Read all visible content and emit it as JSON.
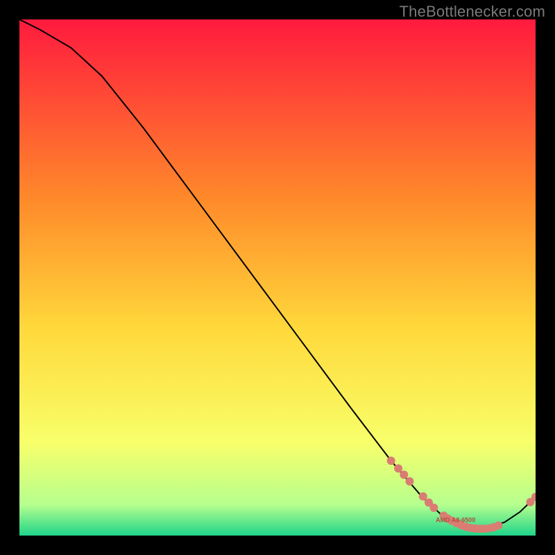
{
  "watermark": "TheBottlenecker.com",
  "colors": {
    "bg": "#000000",
    "curve": "#000000",
    "marker": "#d97d73",
    "label": "#b84a3f",
    "gradient_top": "#ff1a3e",
    "gradient_mid1": "#ff8a2a",
    "gradient_mid2": "#ffd93b",
    "gradient_mid3": "#f8ff6a",
    "gradient_mid4": "#b6ff8e",
    "gradient_bottom": "#1fd48a"
  },
  "chart_data": {
    "type": "line",
    "title": "",
    "xlabel": "",
    "ylabel": "",
    "xlim": [
      0,
      100
    ],
    "ylim": [
      0,
      100
    ],
    "label_text": "AMD A8-6500",
    "curve": [
      {
        "x": 0,
        "y": 100
      },
      {
        "x": 4,
        "y": 98
      },
      {
        "x": 10,
        "y": 94.5
      },
      {
        "x": 16,
        "y": 89
      },
      {
        "x": 24,
        "y": 79
      },
      {
        "x": 34,
        "y": 65.5
      },
      {
        "x": 44,
        "y": 52
      },
      {
        "x": 54,
        "y": 38.5
      },
      {
        "x": 64,
        "y": 25
      },
      {
        "x": 72,
        "y": 14.5
      },
      {
        "x": 78,
        "y": 7.5
      },
      {
        "x": 82,
        "y": 3.8
      },
      {
        "x": 86,
        "y": 1.7
      },
      {
        "x": 90,
        "y": 1.3
      },
      {
        "x": 94,
        "y": 2.6
      },
      {
        "x": 97,
        "y": 4.6
      },
      {
        "x": 100,
        "y": 7.5
      }
    ],
    "markers": [
      {
        "x": 72.0,
        "y": 14.5
      },
      {
        "x": 73.4,
        "y": 13.0
      },
      {
        "x": 74.5,
        "y": 11.8
      },
      {
        "x": 75.6,
        "y": 10.5
      },
      {
        "x": 78.2,
        "y": 7.6
      },
      {
        "x": 79.3,
        "y": 6.4
      },
      {
        "x": 80.3,
        "y": 5.4
      },
      {
        "x": 82.2,
        "y": 3.85
      },
      {
        "x": 83.0,
        "y": 3.3
      },
      {
        "x": 83.8,
        "y": 2.85
      },
      {
        "x": 84.7,
        "y": 2.4
      },
      {
        "x": 85.6,
        "y": 2.0
      },
      {
        "x": 86.5,
        "y": 1.7
      },
      {
        "x": 87.4,
        "y": 1.5
      },
      {
        "x": 88.3,
        "y": 1.38
      },
      {
        "x": 89.2,
        "y": 1.32
      },
      {
        "x": 90.1,
        "y": 1.32
      },
      {
        "x": 91.0,
        "y": 1.42
      },
      {
        "x": 91.9,
        "y": 1.62
      },
      {
        "x": 92.8,
        "y": 1.95
      },
      {
        "x": 99.0,
        "y": 6.5
      },
      {
        "x": 100.0,
        "y": 7.5
      }
    ],
    "label_pos": {
      "x": 84.5,
      "y": 2.6
    }
  }
}
